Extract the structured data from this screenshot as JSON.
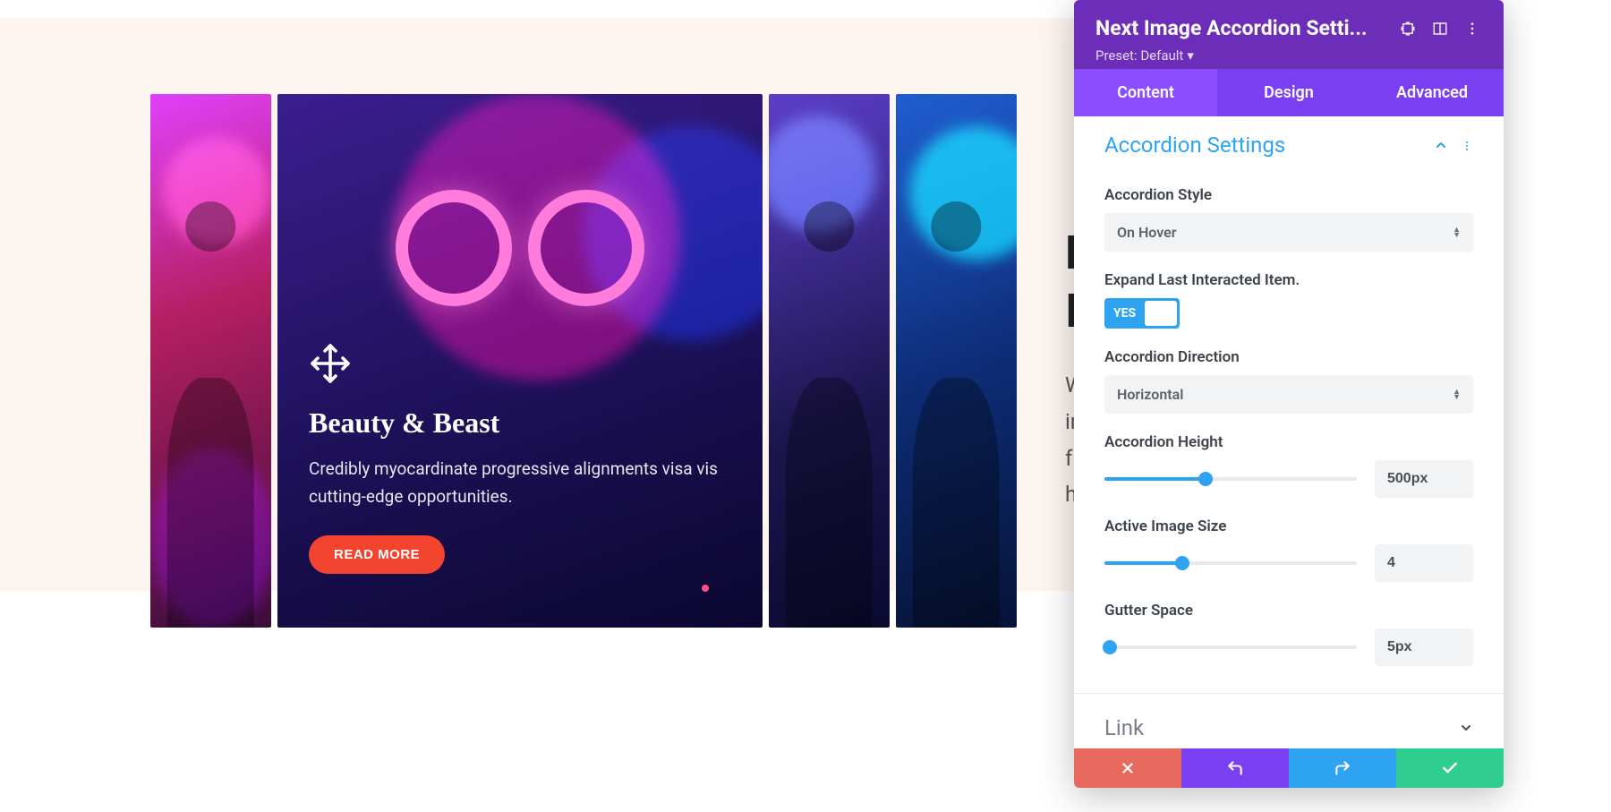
{
  "canvas": {
    "active_slide": {
      "title": "Beauty & Beast",
      "description": "Credibly myocardinate progressive alignments visa vis cutting-edge opportunities.",
      "button_label": "READ MORE"
    }
  },
  "side_text": {
    "heading_line1": "Ex",
    "heading_line2": "Ite",
    "body_line1": "Wh",
    "body_line2": "ima",
    "body_line3": "full",
    "body_line4": "hig"
  },
  "panel": {
    "title": "Next Image Accordion Setti...",
    "preset_label": "Preset: Default",
    "tabs": {
      "content": "Content",
      "design": "Design",
      "advanced": "Advanced"
    },
    "sections": {
      "accordion_settings": {
        "title": "Accordion Settings",
        "fields": {
          "accordion_style": {
            "label": "Accordion Style",
            "value": "On Hover"
          },
          "expand_last": {
            "label": "Expand Last Interacted Item.",
            "value": "YES"
          },
          "direction": {
            "label": "Accordion Direction",
            "value": "Horizontal"
          },
          "height": {
            "label": "Accordion Height",
            "value": "500px",
            "fill_pct": 40
          },
          "active_size": {
            "label": "Active Image Size",
            "value": "4",
            "fill_pct": 31
          },
          "gutter": {
            "label": "Gutter Space",
            "value": "5px",
            "fill_pct": 2
          }
        }
      },
      "link": {
        "title": "Link"
      }
    }
  }
}
